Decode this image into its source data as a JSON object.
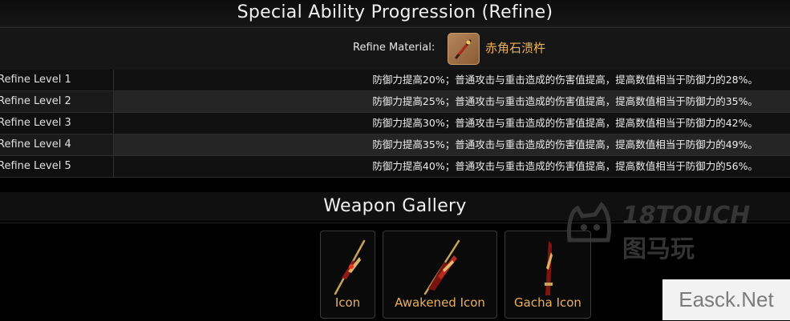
{
  "refine_section": {
    "title": "Special Ability Progression (Refine)",
    "material_label": "Refine Material:",
    "material_icon": "material-icon",
    "material_name": "赤角石溃杵",
    "rows": [
      {
        "level": "Refine Level 1",
        "desc": "防御力提高20%；普通攻击与重击造成的伤害值提高，提高数值相当于防御力的28%。"
      },
      {
        "level": "Refine Level 2",
        "desc": "防御力提高25%；普通攻击与重击造成的伤害值提高，提高数值相当于防御力的35%。"
      },
      {
        "level": "Refine Level 3",
        "desc": "防御力提高30%；普通攻击与重击造成的伤害值提高，提高数值相当于防御力的42%。"
      },
      {
        "level": "Refine Level 4",
        "desc": "防御力提高35%；普通攻击与重击造成的伤害值提高，提高数值相当于防御力的49%。"
      },
      {
        "level": "Refine Level 5",
        "desc": "防御力提高40%；普通攻击与重击造成的伤害值提高，提高数值相当于防御力的56%。"
      }
    ]
  },
  "gallery": {
    "title": "Weapon Gallery",
    "cards": [
      {
        "caption": "Icon",
        "icon": "weapon-icon"
      },
      {
        "caption": "Awakened Icon",
        "icon": "weapon-awakened-icon"
      },
      {
        "caption": "Gacha Icon",
        "icon": "weapon-gacha-icon"
      }
    ]
  },
  "watermark": {
    "line1": "18TOUCH",
    "line2": "图马玩"
  },
  "corner_badge": "Easck.Net",
  "colors": {
    "accent": "#e8b15d",
    "background": "#000000",
    "row_alt": "#252525"
  }
}
